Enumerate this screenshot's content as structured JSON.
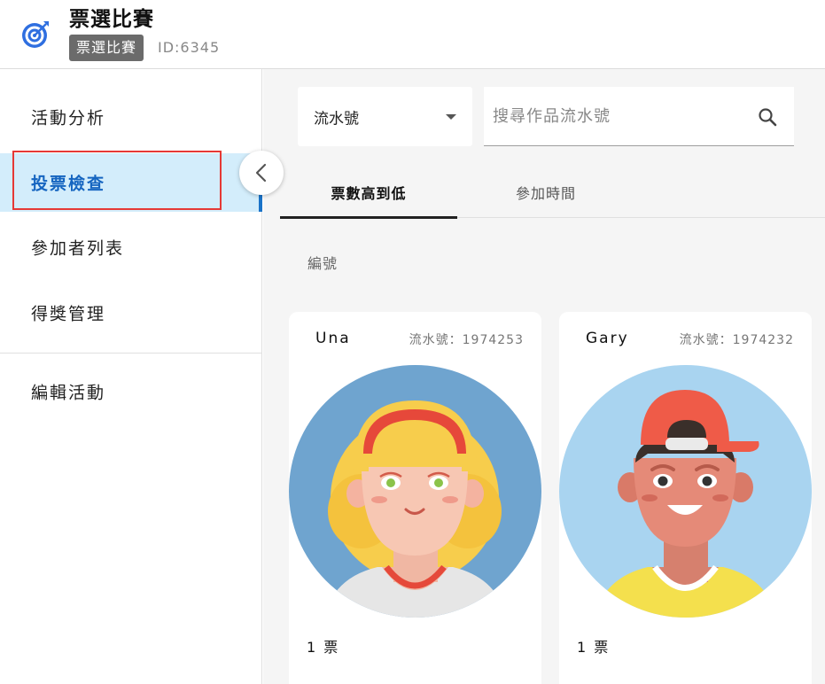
{
  "header": {
    "title": "票選比賽",
    "tag": "票選比賽",
    "activity_id": "ID:6345",
    "logo_icon": "target-icon",
    "accent": "#2f6fe0"
  },
  "sidebar": {
    "items": [
      {
        "label": "活動分析"
      },
      {
        "label": "投票檢查",
        "active": true
      },
      {
        "label": "參加者列表"
      },
      {
        "label": "得獎管理"
      },
      {
        "label": "編輯活動"
      }
    ],
    "active_bg": "#d3edfb",
    "active_color": "#1565c0",
    "highlight_color": "#e53935"
  },
  "toolbar": {
    "filter_value": "流水號",
    "search_placeholder": "搜尋作品流水號"
  },
  "tabs": [
    {
      "label": "票數高到低",
      "active": true
    },
    {
      "label": "參加時間"
    }
  ],
  "sort_label": "編號",
  "cards": [
    {
      "name": "Una",
      "serial": "流水號：1974253",
      "votes": "1 票",
      "avatar_icon": "girl-avatar"
    },
    {
      "name": "Gary",
      "serial": "流水號：1974232",
      "votes": "1 票",
      "avatar_icon": "boy-avatar"
    }
  ]
}
